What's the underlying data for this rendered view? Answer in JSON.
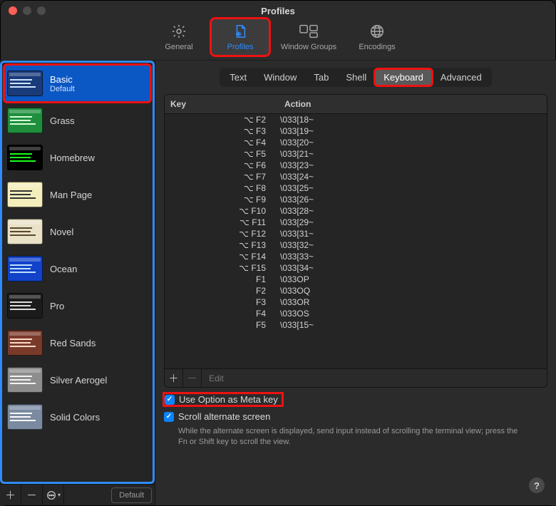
{
  "window": {
    "title": "Profiles"
  },
  "toolbar": {
    "items": [
      {
        "label": "General"
      },
      {
        "label": "Profiles"
      },
      {
        "label": "Window Groups"
      },
      {
        "label": "Encodings"
      }
    ]
  },
  "sidebar": {
    "items": [
      {
        "name": "Basic",
        "sub": "Default",
        "bg": "#1a3b7a",
        "lines": "#cfe3ff"
      },
      {
        "name": "Grass",
        "bg": "#1f8f3e",
        "lines": "#d6ffd6"
      },
      {
        "name": "Homebrew",
        "bg": "#000000",
        "lines": "#18ff18"
      },
      {
        "name": "Man Page",
        "bg": "#f3eebc",
        "lines": "#333"
      },
      {
        "name": "Novel",
        "bg": "#e9e1c8",
        "lines": "#5a4a2a"
      },
      {
        "name": "Ocean",
        "bg": "#1142c9",
        "lines": "#bfe0ff"
      },
      {
        "name": "Pro",
        "bg": "#1b1b1b",
        "lines": "#dcdcdc"
      },
      {
        "name": "Red Sands",
        "bg": "#7a3a2a",
        "lines": "#ffd9c9"
      },
      {
        "name": "Silver Aerogel",
        "bg": "#8d8d8d",
        "lines": "#f3f3f3"
      },
      {
        "name": "Solid Colors",
        "bg": "#7a8aa0",
        "lines": "#ffffff"
      }
    ],
    "footer": {
      "default_label": "Default"
    }
  },
  "content": {
    "tabs": [
      "Text",
      "Window",
      "Tab",
      "Shell",
      "Keyboard",
      "Advanced"
    ],
    "table": {
      "headers": {
        "key": "Key",
        "action": "Action"
      },
      "rows": [
        {
          "key": "⌥ F2",
          "action": "\\033[18~"
        },
        {
          "key": "⌥ F3",
          "action": "\\033[19~"
        },
        {
          "key": "⌥ F4",
          "action": "\\033[20~"
        },
        {
          "key": "⌥ F5",
          "action": "\\033[21~"
        },
        {
          "key": "⌥ F6",
          "action": "\\033[23~"
        },
        {
          "key": "⌥ F7",
          "action": "\\033[24~"
        },
        {
          "key": "⌥ F8",
          "action": "\\033[25~"
        },
        {
          "key": "⌥ F9",
          "action": "\\033[26~"
        },
        {
          "key": "⌥ F10",
          "action": "\\033[28~"
        },
        {
          "key": "⌥ F11",
          "action": "\\033[29~"
        },
        {
          "key": "⌥ F12",
          "action": "\\033[31~"
        },
        {
          "key": "⌥ F13",
          "action": "\\033[32~"
        },
        {
          "key": "⌥ F14",
          "action": "\\033[33~"
        },
        {
          "key": "⌥ F15",
          "action": "\\033[34~"
        },
        {
          "key": "F1",
          "action": "\\033OP"
        },
        {
          "key": "F2",
          "action": "\\033OQ"
        },
        {
          "key": "F3",
          "action": "\\033OR"
        },
        {
          "key": "F4",
          "action": "\\033OS"
        },
        {
          "key": "F5",
          "action": "\\033[15~"
        }
      ],
      "edit_label": "Edit"
    },
    "check1": "Use Option as Meta key",
    "check2": "Scroll alternate screen",
    "footer_text": "While the alternate screen is displayed, send input instead of scrolling the terminal view; press the Fn or Shift key to scroll the view."
  }
}
